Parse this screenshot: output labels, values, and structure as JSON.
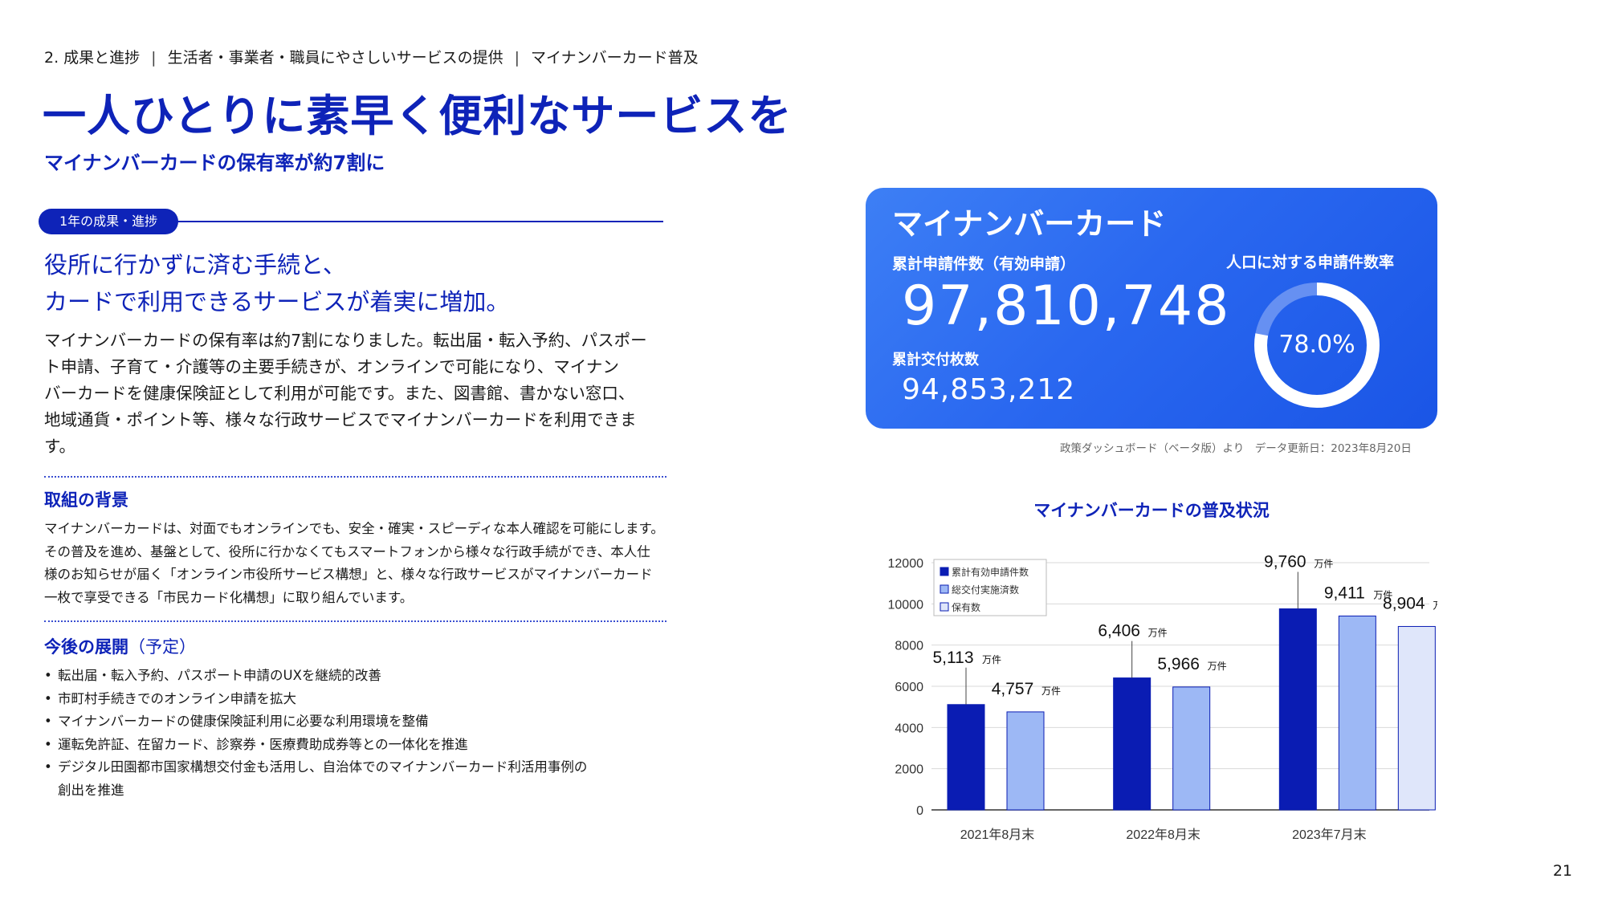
{
  "header": {
    "breadcrumb": [
      "2. 成果と進捗",
      "生活者・事業者・職員にやさしいサービスの提供",
      "マイナンバーカード普及"
    ],
    "title": "一人ひとりに素早く便利なサービスを",
    "subtitle": "マイナンバーカードの保有率が約7割に"
  },
  "left": {
    "badge": "1年の成果・進捗",
    "lead_lines": [
      "役所に行かずに済む手続と、",
      "カードで利用できるサービスが着実に増加。"
    ],
    "body_lines": [
      "マイナンバーカードの保有率は約7割になりました。転出届・転入予約、パスポー",
      "ト申請、子育て・介護等の主要手続きが、オンラインで可能になり、マイナン",
      "バーカードを健康保険証として利用が可能です。また、図書館、書かない窓口、",
      "地域通貨・ポイント等、様々な行政サービスでマイナンバーカードを利用できま",
      "す。"
    ],
    "background_heading": "取組の背景",
    "background_lines": [
      "マイナンバーカードは、対面でもオンラインでも、安全・確実・スピーディな本人確認を可能にします。",
      "その普及を進め、基盤として、役所に行かなくてもスマートフォンから様々な行政手続ができ、本人仕",
      "様のお知らせが届く「オンライン市役所サービス構想」と、様々な行政サービスがマイナンバーカード",
      "一枚で享受できる「市民カード化構想」に取り組んでいます。"
    ],
    "future_heading": "今後の展開",
    "future_heading_note": "（予定）",
    "future_items": [
      "転出届・転入予約、パスポート申請のUXを継続的改善",
      "市町村手続きでのオンライン申請を拡大",
      "マイナンバーカードの健康保険証利用に必要な利用環境を整備",
      "運転免許証、在留カード、診察券・医療費助成券等との一体化を推進",
      "デジタル田園都市国家構想交付金も活用し、自治体でのマイナンバーカード利活用事例の",
      "創出を推進"
    ]
  },
  "card": {
    "title": "マイナンバーカード",
    "apply_label": "累計申請件数（有効申請）",
    "apply_value": "97,810,748",
    "issued_label": "累計交付枚数",
    "issued_value": "94,853,212",
    "rate_label": "人口に対する申請件数率",
    "rate_value": "78.0%",
    "rate_fraction": 0.78,
    "source": "政策ダッシュボード（ベータ版）より　データ更新日：2023年8月20日"
  },
  "chart_title": "マイナンバーカードの普及状況",
  "chart_data": {
    "type": "bar",
    "categories": [
      "2021年8月末",
      "2022年8月末",
      "2023年7月末"
    ],
    "series": [
      {
        "name": "累計有効申請件数",
        "values": [
          5113,
          6406,
          9760
        ],
        "labels": [
          "5,113",
          "6,406",
          "9,760"
        ],
        "color": "#0a1cb3"
      },
      {
        "name": "総交付実施済数",
        "values": [
          4757,
          5966,
          9411
        ],
        "labels": [
          "4,757",
          "5,966",
          "9,411"
        ],
        "color": "#9db8f5"
      },
      {
        "name": "保有数",
        "values": [
          null,
          null,
          8904
        ],
        "labels": [
          null,
          null,
          "8,904"
        ],
        "color": "#dfe6fa"
      }
    ],
    "unit_label": "万件",
    "ylim": [
      0,
      12000
    ],
    "yticks": [
      0,
      2000,
      4000,
      6000,
      8000,
      10000,
      12000
    ],
    "grid": true,
    "legend_position": "top-left"
  },
  "page_number": "21"
}
